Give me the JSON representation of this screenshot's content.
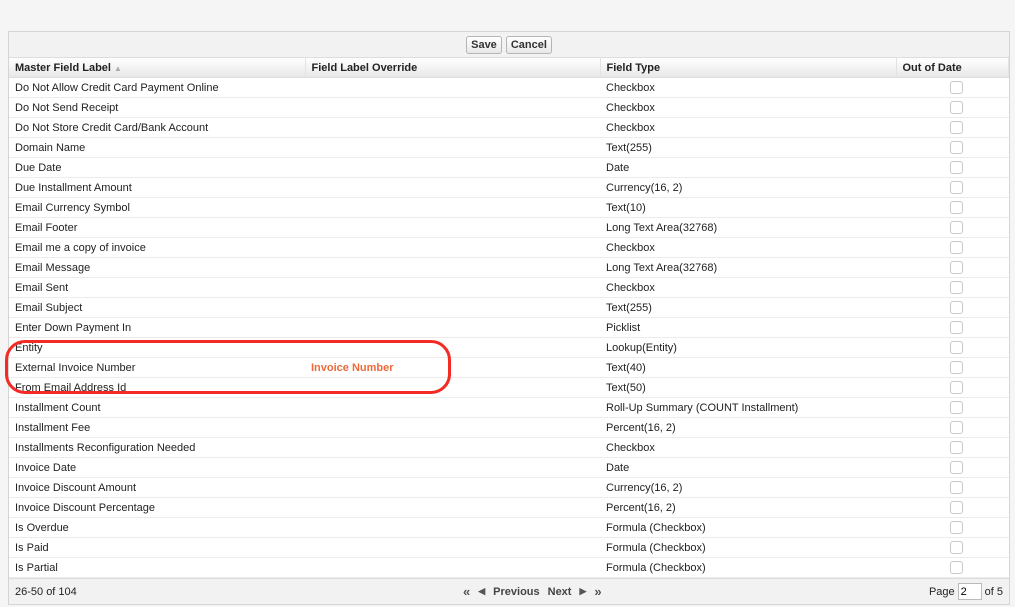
{
  "toolbar": {
    "save_label": "Save",
    "cancel_label": "Cancel"
  },
  "columns": [
    "Master Field Label",
    "Field Label Override",
    "Field Type",
    "Out of Date"
  ],
  "sort_icon": "▲",
  "rows": [
    [
      "Do Not Allow Credit Card Payment Online",
      "",
      "Checkbox"
    ],
    [
      "Do Not Send Receipt",
      "",
      "Checkbox"
    ],
    [
      "Do Not Store Credit Card/Bank Account",
      "",
      "Checkbox"
    ],
    [
      "Domain Name",
      "",
      "Text(255)"
    ],
    [
      "Due Date",
      "",
      "Date"
    ],
    [
      "Due Installment Amount",
      "",
      "Currency(16, 2)"
    ],
    [
      "Email Currency Symbol",
      "",
      "Text(10)"
    ],
    [
      "Email Footer",
      "",
      "Long Text Area(32768)"
    ],
    [
      "Email me a copy of invoice",
      "",
      "Checkbox"
    ],
    [
      "Email Message",
      "",
      "Long Text Area(32768)"
    ],
    [
      "Email Sent",
      "",
      "Checkbox"
    ],
    [
      "Email Subject",
      "",
      "Text(255)"
    ],
    [
      "Enter Down Payment In",
      "",
      "Picklist"
    ],
    [
      "Entity",
      "",
      "Lookup(Entity)"
    ],
    [
      "External Invoice Number",
      "Invoice Number",
      "Text(40)"
    ],
    [
      "From Email Address Id",
      "",
      "Text(50)"
    ],
    [
      "Installment Count",
      "",
      "Roll-Up Summary (COUNT Installment)"
    ],
    [
      "Installment Fee",
      "",
      "Percent(16, 2)"
    ],
    [
      "Installments Reconfiguration Needed",
      "",
      "Checkbox"
    ],
    [
      "Invoice Date",
      "",
      "Date"
    ],
    [
      "Invoice Discount Amount",
      "",
      "Currency(16, 2)"
    ],
    [
      "Invoice Discount Percentage",
      "",
      "Percent(16, 2)"
    ],
    [
      "Is Overdue",
      "",
      "Formula (Checkbox)"
    ],
    [
      "Is Paid",
      "",
      "Formula (Checkbox)"
    ],
    [
      "Is Partial",
      "",
      "Formula (Checkbox)"
    ]
  ],
  "footer": {
    "range": "26-50 of 104",
    "first": "«",
    "prev_arrow": "◀",
    "previous": "Previous",
    "next": "Next",
    "next_arrow": "▶",
    "last": "»",
    "page_label": "Page",
    "page_value": "2",
    "of_label": "of 5"
  }
}
